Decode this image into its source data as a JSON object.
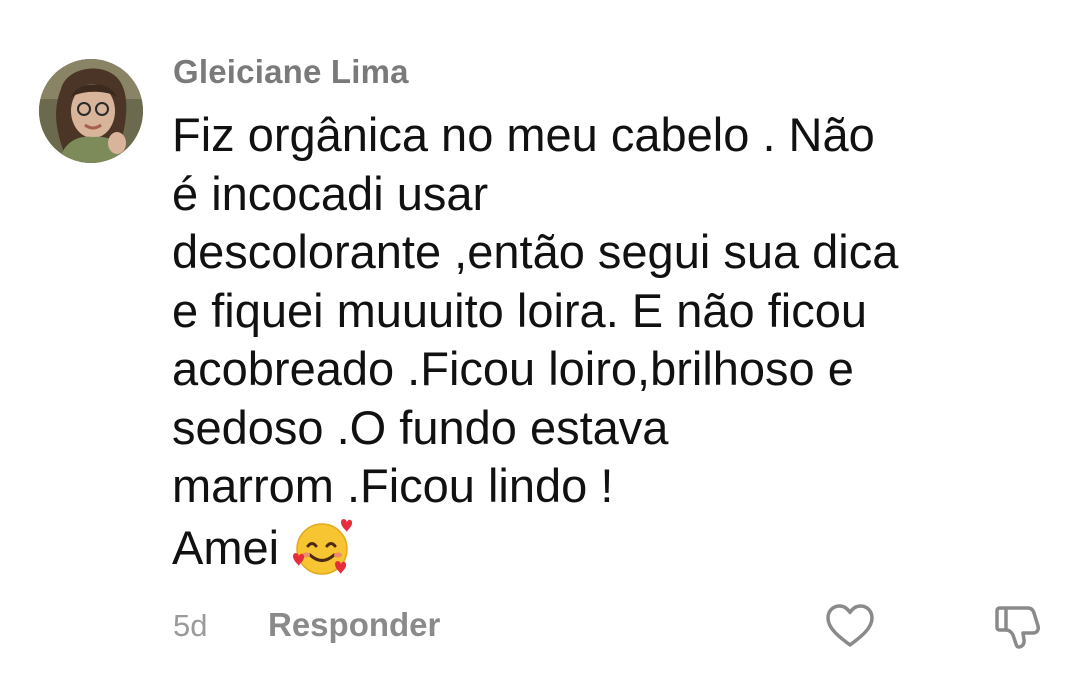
{
  "comment": {
    "author": "Gleiciane Lima",
    "avatar_icon": "user-photo-avatar",
    "body_lines": [
      "Fiz orgânica no meu cabelo . Não",
      "é incocadi usar",
      "descolorante ,então segui sua dica",
      "e fiquei muuuito loira. E não ficou",
      "acobreado .Ficou loiro,brilhoso e",
      "sedoso .O fundo estava",
      "marrom .Ficou lindo !",
      "Amei"
    ],
    "emoji_icon": "smiling-face-with-hearts-emoji",
    "timestamp": "5d",
    "reply_label": "Responder",
    "like_icon": "heart-outline-icon",
    "dislike_icon": "thumbs-down-outline-icon"
  },
  "colors": {
    "author": "#7a7a7a",
    "body": "#111111",
    "timestamp": "#9a9a9a",
    "reply": "#8a8a8a",
    "icons": "#8a8a8a"
  }
}
